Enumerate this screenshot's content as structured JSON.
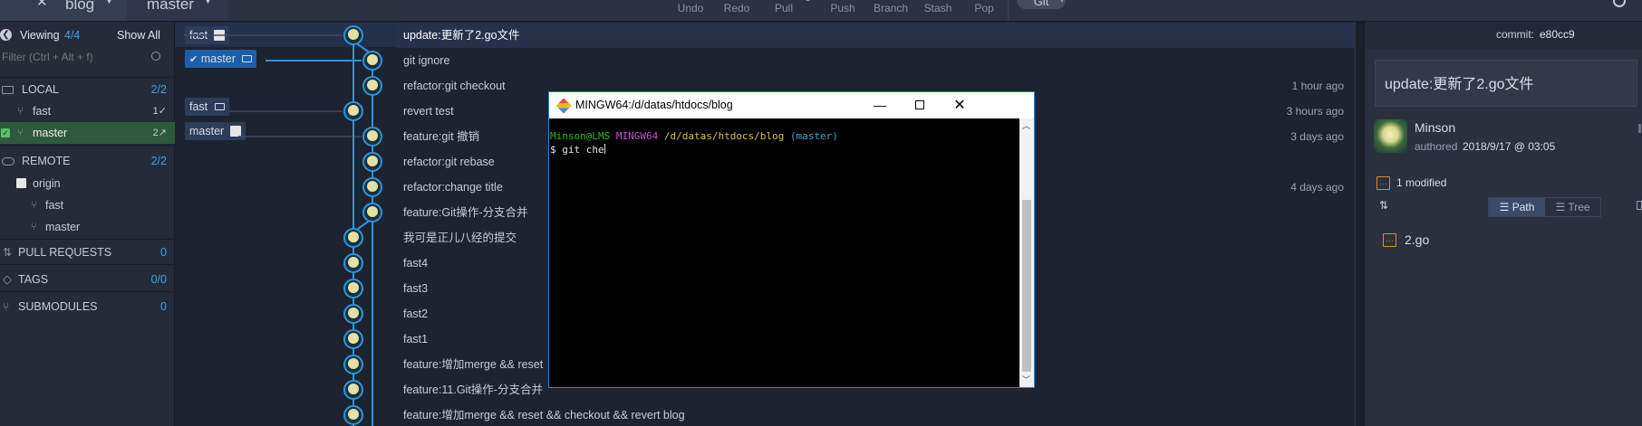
{
  "toolbar": {
    "tabs": [
      {
        "label": "blog"
      },
      {
        "label": "master"
      }
    ],
    "buttons": [
      {
        "label": "Undo"
      },
      {
        "label": "Redo"
      },
      {
        "label": "Pull"
      },
      {
        "label": "Push"
      },
      {
        "label": "Branch"
      },
      {
        "label": "Stash"
      },
      {
        "label": "Pop"
      }
    ],
    "profile_label": "Git"
  },
  "sidebar": {
    "viewing_label": "Viewing",
    "viewing_count": "4/4",
    "show_all": "Show All",
    "filter_placeholder": "Filter (Ctrl + Alt + f)",
    "local": {
      "label": "LOCAL",
      "count": "2/2"
    },
    "local_branches": [
      {
        "name": "fast",
        "status": "1✓"
      },
      {
        "name": "master",
        "status": "2↗"
      }
    ],
    "remote": {
      "label": "REMOTE",
      "count": "2/2"
    },
    "remote_origin": "origin",
    "remote_branches": [
      {
        "name": "fast"
      },
      {
        "name": "master"
      }
    ],
    "pull_requests": {
      "label": "PULL REQUESTS",
      "count": "0"
    },
    "tags": {
      "label": "TAGS",
      "count": "0/0"
    },
    "submodules": {
      "label": "SUBMODULES",
      "count": "0"
    }
  },
  "graph_tags": [
    {
      "label": "fast"
    },
    {
      "label": "master"
    },
    {
      "label": "fast"
    },
    {
      "label": "master"
    }
  ],
  "commits": [
    {
      "message": "update:更新了2.go文件",
      "time": ""
    },
    {
      "message": "git ignore",
      "time": ""
    },
    {
      "message": "refactor:git checkout",
      "time": "1 hour ago"
    },
    {
      "message": "revert test",
      "time": "3 hours ago"
    },
    {
      "message": "feature:git 撤销",
      "time": "3 days ago"
    },
    {
      "message": "refactor:git rebase",
      "time": ""
    },
    {
      "message": "refactor:change title",
      "time": "4 days ago"
    },
    {
      "message": "feature:Git操作-分支合并",
      "time": ""
    },
    {
      "message": "我可是正儿八经的提交",
      "time": ""
    },
    {
      "message": "fast4",
      "time": ""
    },
    {
      "message": "fast3",
      "time": ""
    },
    {
      "message": "fast2",
      "time": ""
    },
    {
      "message": "fast1",
      "time": ""
    },
    {
      "message": "feature:增加merge && reset",
      "time": ""
    },
    {
      "message": "feature:11.Git操作-分支合并",
      "time": ""
    },
    {
      "message": "feature:增加merge && reset && checkout && revert blog",
      "time": ""
    }
  ],
  "terminal": {
    "title": "MINGW64:/d/datas/htdocs/blog",
    "user": "Minson@LMS",
    "system": "MINGW64",
    "path": "/d/datas/htdocs/blog",
    "branch": "(master)",
    "command": "$ git che"
  },
  "details": {
    "commit_label": "commit:",
    "commit_hash": "e80cc9",
    "message": "update:更新了2.go文件",
    "author": "Minson",
    "authored_label": "authored",
    "date": "2018/9/17 @ 03:05",
    "modified": "1 modified",
    "path_label": "Path",
    "tree_label": "Tree",
    "files": [
      {
        "name": "2.go"
      }
    ]
  },
  "colors": {
    "accent": "#3ba3e8",
    "local_branch_bg": "#1c5fa8",
    "remote_branch_bg": "#2d3d57",
    "graph_line": "#2b95dc",
    "file_modified": "#e08b2c"
  }
}
